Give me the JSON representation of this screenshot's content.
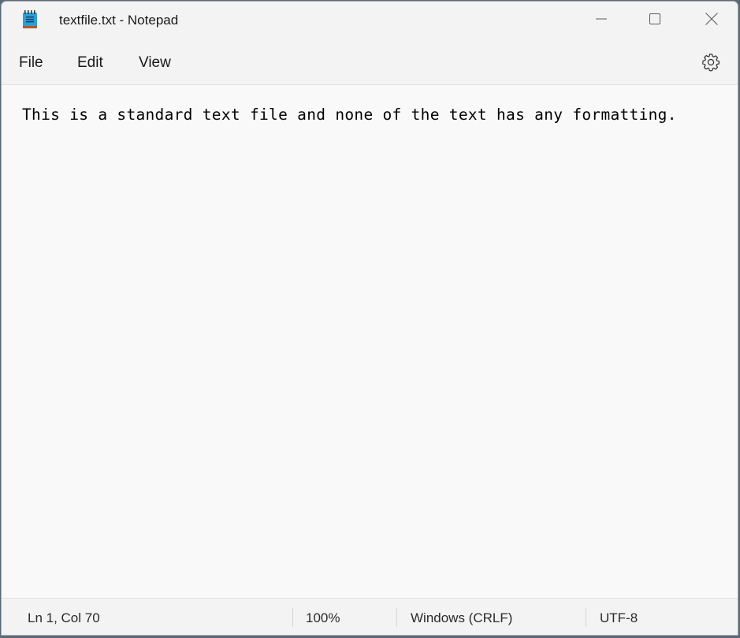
{
  "window": {
    "title": "textfile.txt - Notepad",
    "icon": "notepad-icon",
    "controls": {
      "minimize_icon": "minimize-icon",
      "maximize_icon": "maximize-icon",
      "close_icon": "close-icon"
    }
  },
  "menu": {
    "items": [
      {
        "label": "File"
      },
      {
        "label": "Edit"
      },
      {
        "label": "View"
      }
    ],
    "settings_icon": "gear-icon"
  },
  "editor": {
    "content": "This is a standard text file and none of the text has any formatting."
  },
  "status": {
    "position": "Ln 1, Col 70",
    "zoom": "100%",
    "line_ending": "Windows (CRLF)",
    "encoding": "UTF-8"
  },
  "colors": {
    "icon_blue": "#2b9fd8",
    "icon_brown": "#b05a2a"
  }
}
